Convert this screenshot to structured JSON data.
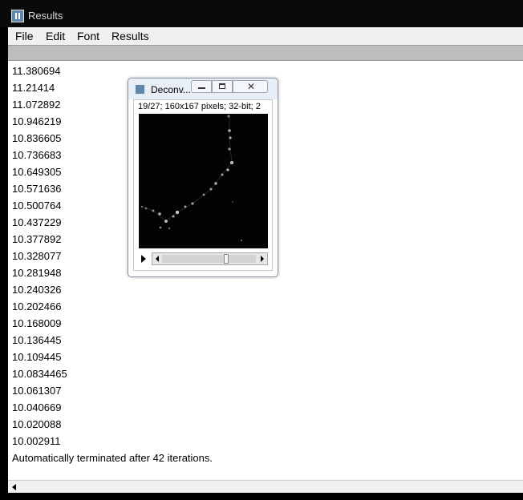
{
  "window": {
    "title": "Results"
  },
  "menu": [
    "File",
    "Edit",
    "Font",
    "Results"
  ],
  "results": {
    "values": [
      "11.380694",
      "11.21414",
      "11.072892",
      "10.946219",
      "10.836605",
      "10.736683",
      "10.649305",
      "10.571636",
      "10.500764",
      "10.437229",
      "10.377892",
      "10.328077",
      "10.281948",
      "10.240326",
      "10.202466",
      "10.168009",
      "10.136445",
      "10.109445",
      "10.0834465",
      "10.061307",
      "10.040669",
      "10.020088",
      "10.002911"
    ],
    "message": "Automatically terminated after 42 iterations."
  },
  "image_window": {
    "title": "Deconv...",
    "info": "19/27; 160x167 pixels; 32-bit; 2",
    "slice_current": 19,
    "slice_total": 27
  }
}
